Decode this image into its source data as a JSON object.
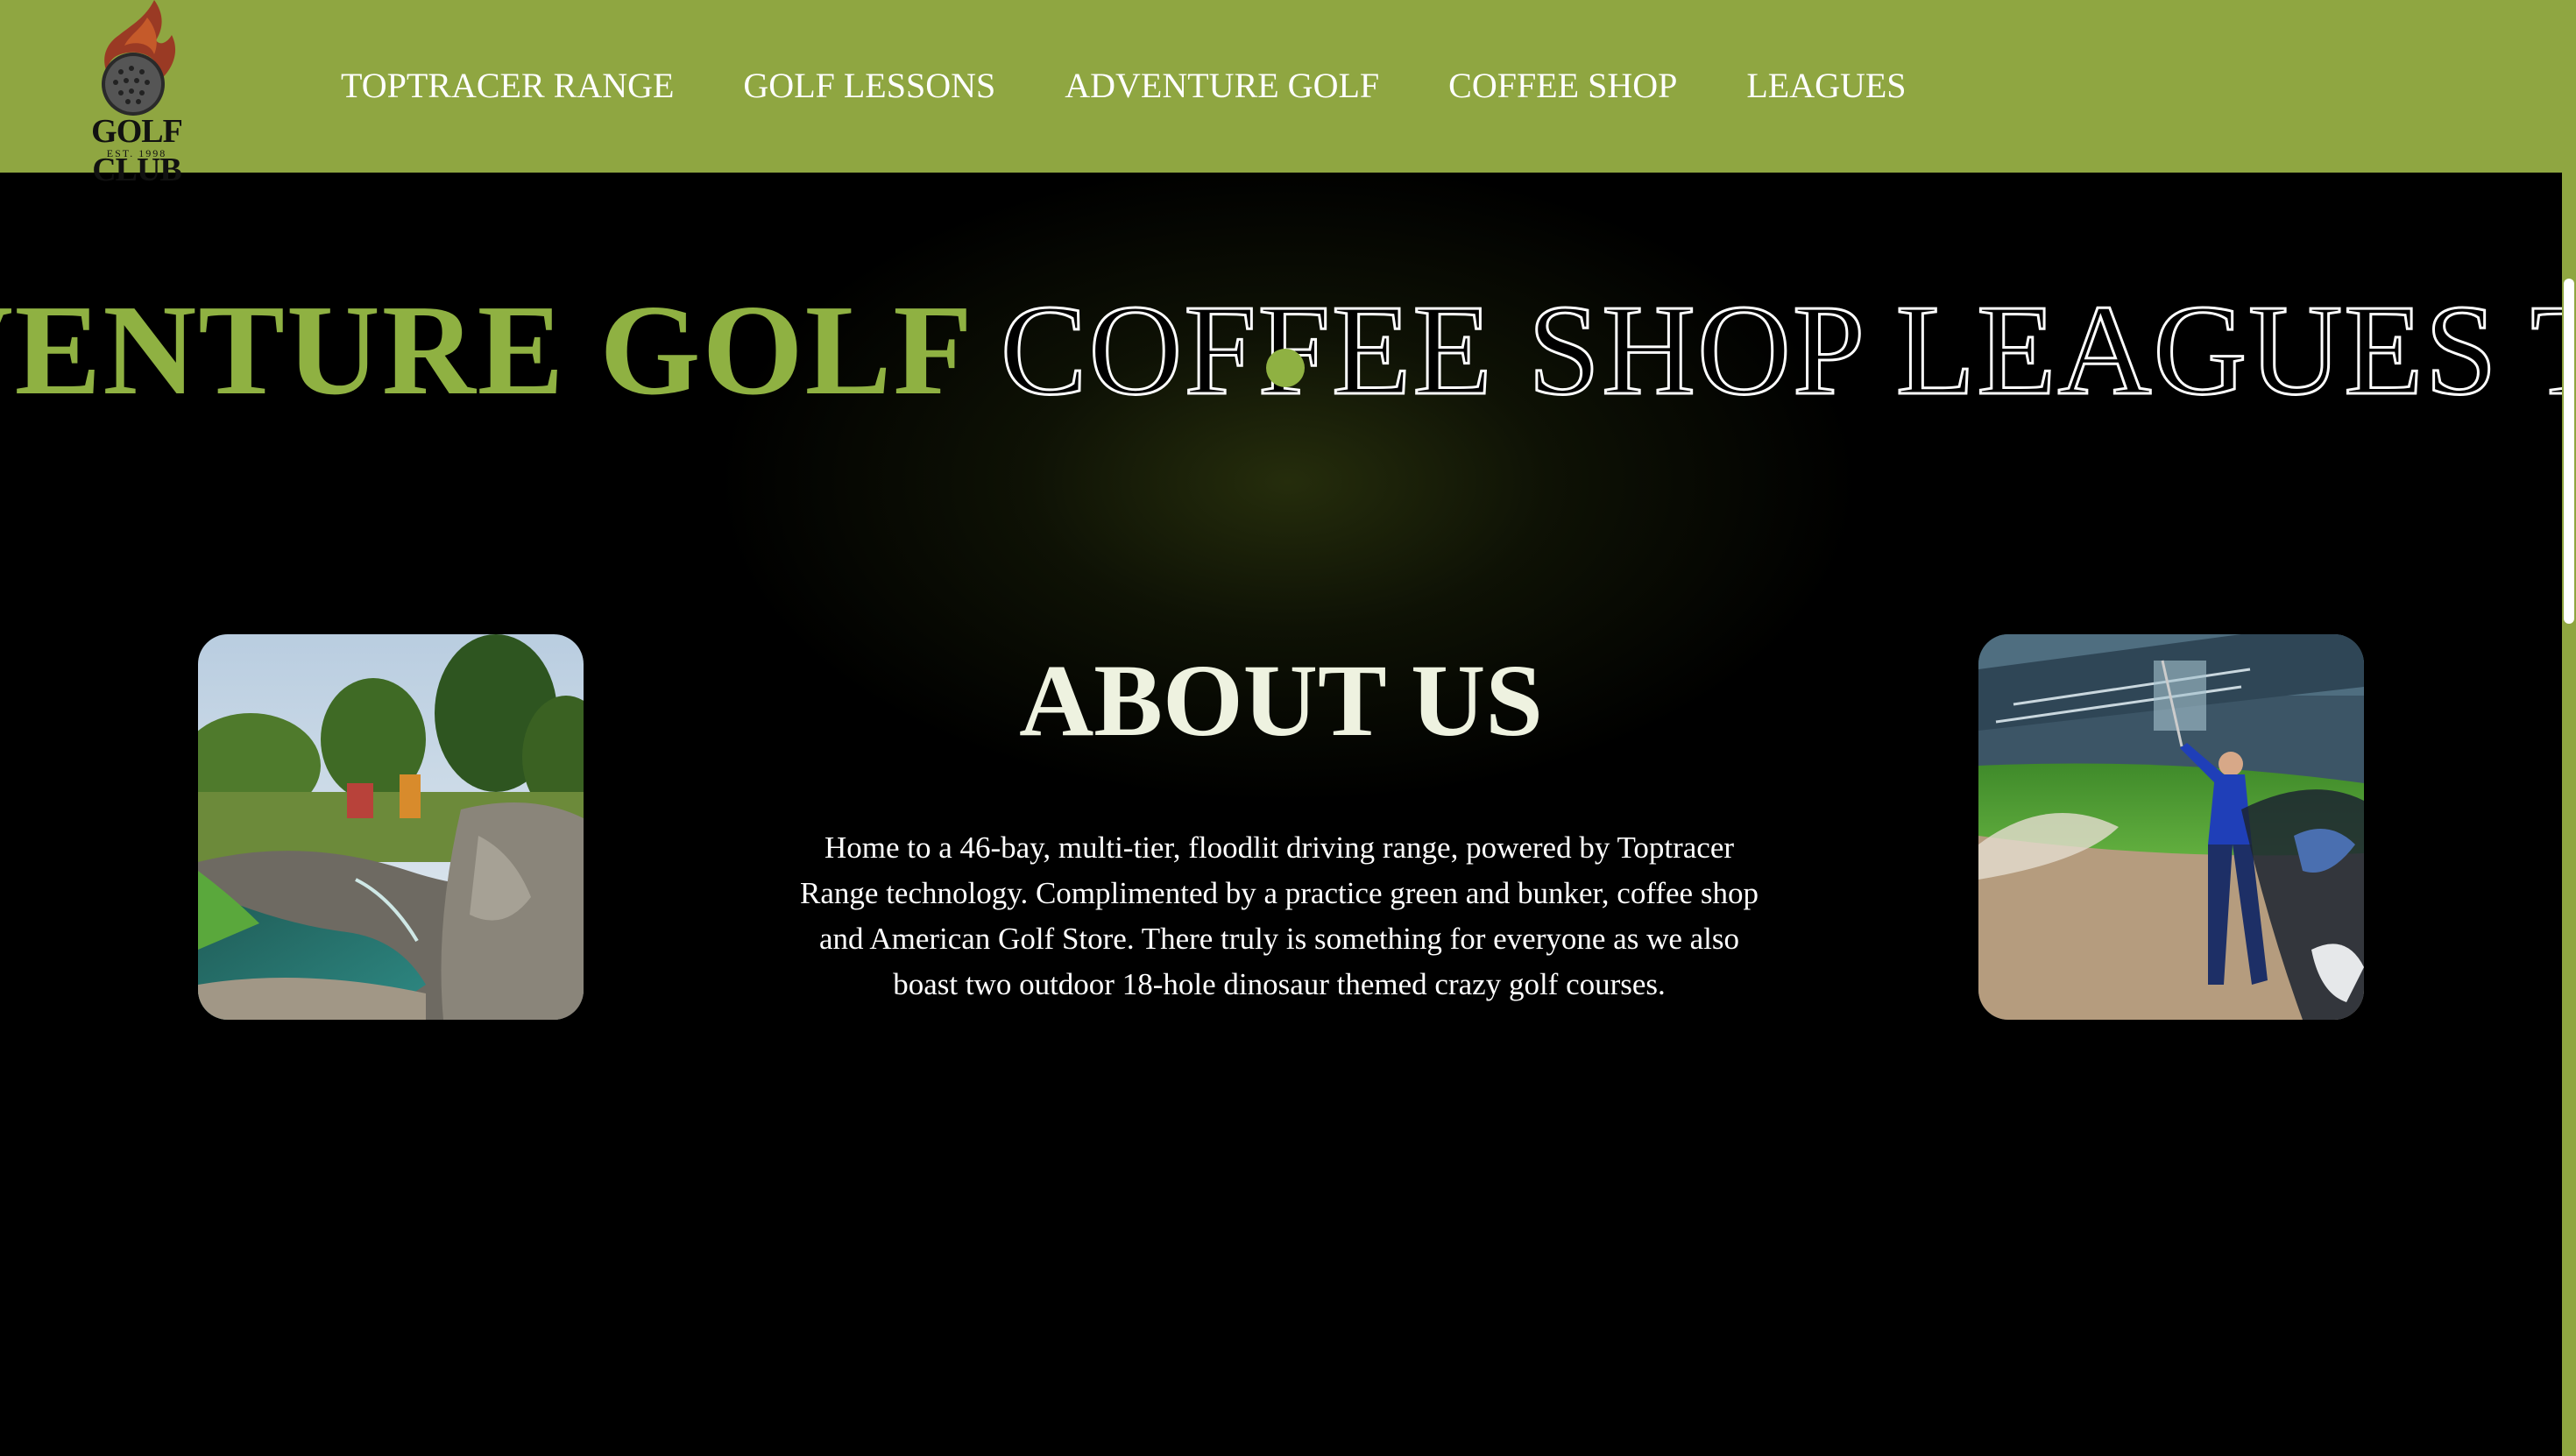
{
  "header": {
    "logo": {
      "name": "GOLF CLUB",
      "est": "EST. 1998"
    },
    "nav": [
      {
        "label": "TOPTRACER RANGE"
      },
      {
        "label": "GOLF LESSONS"
      },
      {
        "label": "ADVENTURE GOLF"
      },
      {
        "label": "COFFEE SHOP"
      },
      {
        "label": "LEAGUES"
      }
    ]
  },
  "marquee": {
    "solid_text": "ADVENTURE GOLF",
    "outline_text": "COFFEE SHOP LEAGUES TOPTRACER RANGE"
  },
  "about": {
    "title": "ABOUT US",
    "body": "Home to a 46-bay, multi-tier, floodlit driving range, powered by Toptracer Range technology. Complimented by a practice green and bunker, coffee shop and American Golf Store. There truly is something for everyone as we also boast two outdoor 18-hole dinosaur themed crazy golf courses."
  },
  "colors": {
    "header_bg": "#8fa641",
    "accent": "#8fb142",
    "page_bg": "#000000",
    "title": "#eef2e0"
  }
}
